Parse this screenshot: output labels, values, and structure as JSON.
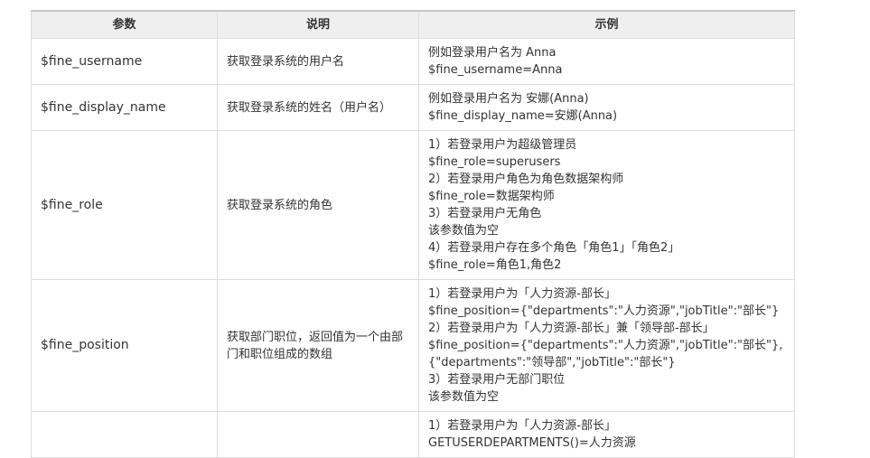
{
  "table": {
    "headers": [
      "参数",
      "说明",
      "示例"
    ],
    "rows": [
      {
        "param": "$fine_username",
        "desc": "获取登录系统的用户名",
        "example": [
          "例如登录用户名为 Anna",
          "$fine_username=Anna"
        ]
      },
      {
        "param": "$fine_display_name",
        "desc": "获取登录系统的姓名（用户名）",
        "example": [
          "例如登录用户名为 安娜(Anna)",
          "$fine_display_name=安娜(Anna)"
        ]
      },
      {
        "param": "$fine_role",
        "desc": "获取登录系统的角色",
        "example": [
          "1）若登录用户为超级管理员",
          "$fine_role=superusers",
          "2）若登录用户角色为角色数据架构师",
          "$fine_role=数据架构师",
          "3）若登录用户无角色",
          "该参数值为空",
          "4）若登录用户存在多个角色「角色1」「角色2」",
          "$fine_role=角色1,角色2"
        ]
      },
      {
        "param": "$fine_position",
        "desc": "获取部门职位，返回值为一个由部门和职位组成的数组",
        "example": [
          "1）若登录用户为「人力资源-部长」",
          "$fine_position={\"departments\":\"人力资源\",\"jobTitle\":\"部长\"}",
          "2）若登录用户为「人力资源-部长」兼「领导部-部长」",
          "$fine_position={\"departments\":\"人力资源\",\"jobTitle\":\"部长\"},{\"departments\":\"领导部\",\"jobTitle\":\"部长\"}",
          "3）若登录用户无部门职位",
          "该参数值为空"
        ]
      },
      {
        "param": "",
        "desc": "",
        "example": [
          "1）若登录用户为「人力资源-部长」",
          "GETUSERDEPARTMENTS()=人力资源"
        ]
      }
    ]
  },
  "colors": {
    "header_bg": "#efefef",
    "border": "#dddddd",
    "text": "#333333"
  }
}
